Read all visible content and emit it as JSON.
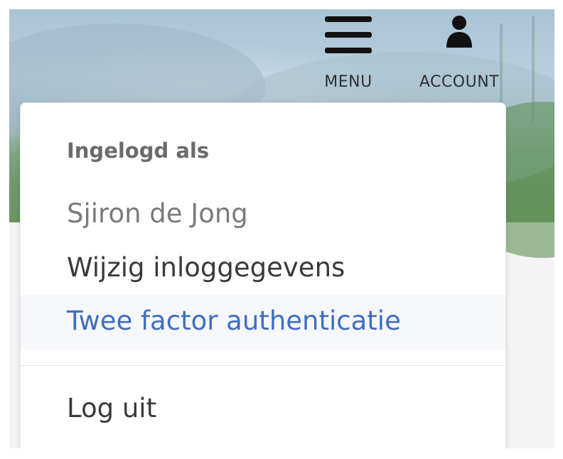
{
  "header": {
    "menu": {
      "label": "MENU",
      "icon": "hamburger-menu-icon"
    },
    "account": {
      "label": "ACCOUNT",
      "icon": "person-icon"
    }
  },
  "account_menu": {
    "heading": "Ingelogd als",
    "username": "Sjiron de Jong",
    "items": [
      {
        "label": "Wijzig inloggegevens"
      },
      {
        "label": "Twee factor authenticatie",
        "highlighted": true
      },
      {
        "label": "Log uit"
      }
    ]
  },
  "colors": {
    "link_highlight": "#3f6ebf",
    "highlight_background": "#f5f7fa",
    "text_dark": "#3a3a3a",
    "text_muted": "#7a7a7a"
  }
}
